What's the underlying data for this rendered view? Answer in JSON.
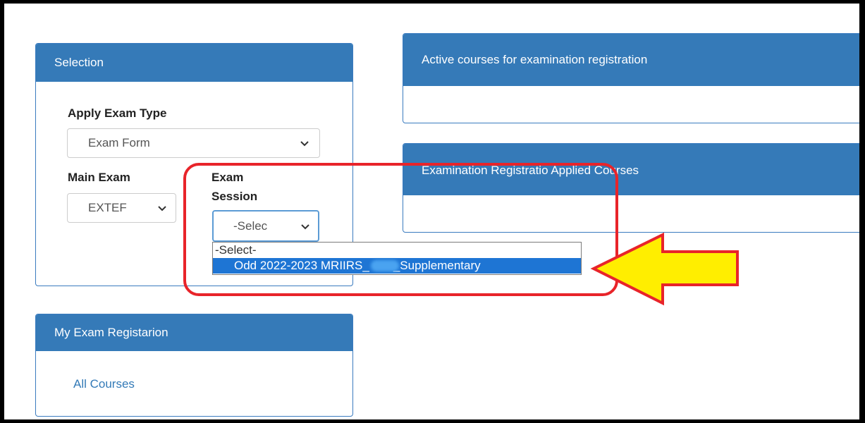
{
  "selection_panel": {
    "title": "Selection",
    "apply_exam_type_label": "Apply Exam Type",
    "apply_exam_type_value": "Exam Form",
    "main_exam_label": "Main Exam",
    "main_exam_value": "EXTEF",
    "exam_session_label_line1": "Exam",
    "exam_session_label_line2": "Session",
    "exam_session_value": "-Selec",
    "exam_session_options": [
      "-Select-",
      "Odd 2022-2023 MRIIRS_",
      "_Supplementary"
    ]
  },
  "active_courses_panel": {
    "title": "Active courses for examination registration"
  },
  "applied_courses_panel": {
    "title": "Examination Registratio Applied Courses"
  },
  "my_exam_panel": {
    "title": "My Exam Registarion",
    "link": "All Courses"
  },
  "annotation": {
    "highlight_color": "#e8242a",
    "arrow_fill": "#ffee00",
    "arrow_stroke": "#e8242a"
  },
  "icons": {
    "select_chevron": "chevron-down-icon"
  }
}
